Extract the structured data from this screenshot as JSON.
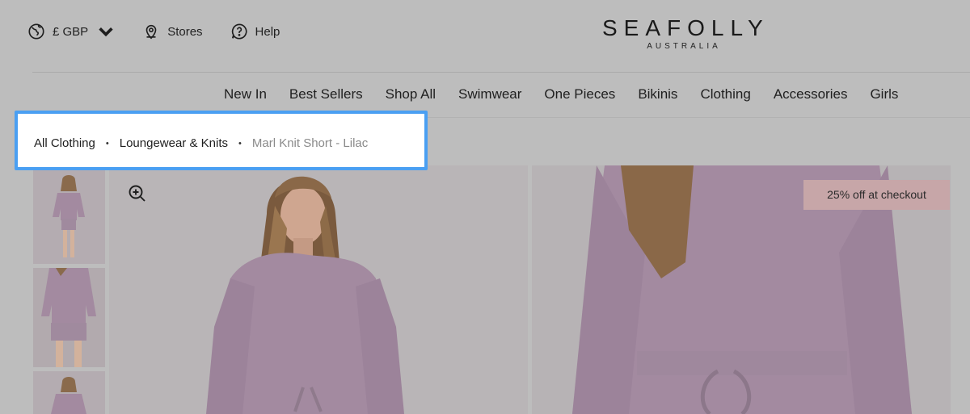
{
  "header": {
    "currency_label": "£ GBP",
    "stores_label": "Stores",
    "help_label": "Help",
    "logo_main": "SEAFOLLY",
    "logo_sub": "AUSTRALIA"
  },
  "nav": {
    "items": [
      "New In",
      "Best Sellers",
      "Shop All",
      "Swimwear",
      "One Pieces",
      "Bikinis",
      "Clothing",
      "Accessories",
      "Girls"
    ]
  },
  "breadcrumb": {
    "items": [
      "All Clothing",
      "Loungewear & Knits"
    ],
    "separator": "•",
    "current": "Marl Knit Short - Lilac"
  },
  "product": {
    "promo_badge": "25% off at checkout"
  },
  "colors": {
    "highlight": "#4a9ff2",
    "garment": "#a38aa0",
    "promo": "#c7a6a8"
  },
  "icons": [
    "globe-icon",
    "chevron-down-icon",
    "location-pin-icon",
    "help-icon",
    "zoom-in-icon"
  ]
}
